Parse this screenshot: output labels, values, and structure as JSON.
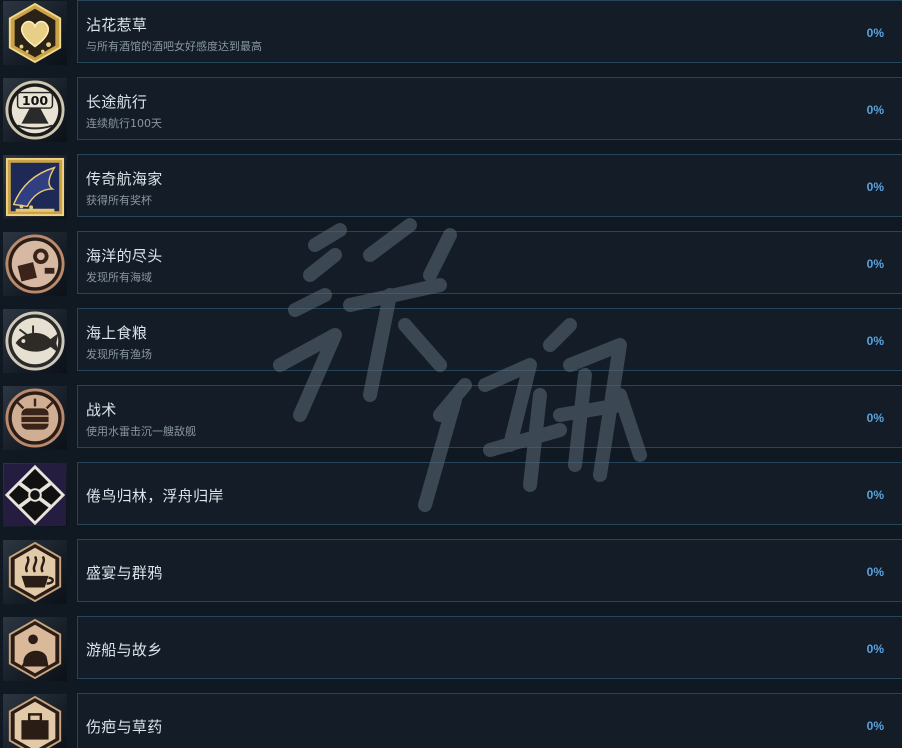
{
  "achievements": [
    {
      "title": "沾花惹草",
      "desc": "与所有酒馆的酒吧女好感度达到最高",
      "percent": "0%",
      "icon": "gold-heart-icon"
    },
    {
      "title": "长途航行",
      "desc": "连续航行100天",
      "percent": "0%",
      "icon": "voyage-100-icon"
    },
    {
      "title": "传奇航海家",
      "desc": "获得所有奖杯",
      "percent": "0%",
      "icon": "golden-whale-trophy-icon"
    },
    {
      "title": "海洋的尽头",
      "desc": "发现所有海域",
      "percent": "0%",
      "icon": "spyglass-map-icon"
    },
    {
      "title": "海上食粮",
      "desc": "发现所有渔场",
      "percent": "0%",
      "icon": "fish-icon"
    },
    {
      "title": "战术",
      "desc": "使用水雷击沉一艘敌舰",
      "percent": "0%",
      "icon": "sea-mine-barrel-icon"
    },
    {
      "title": "倦鸟归林，浮舟归岸",
      "desc": "",
      "percent": "0%",
      "icon": "crossed-swords-diamond-icon"
    },
    {
      "title": "盛宴与群鸦",
      "desc": "",
      "percent": "0%",
      "icon": "steaming-cup-icon"
    },
    {
      "title": "游船与故乡",
      "desc": "",
      "percent": "0%",
      "icon": "silhouette-scene-icon"
    },
    {
      "title": "伤疤与草药",
      "desc": "",
      "percent": "0%",
      "icon": "medicine-chest-icon"
    }
  ],
  "watermark": {
    "text": "游侠网"
  }
}
